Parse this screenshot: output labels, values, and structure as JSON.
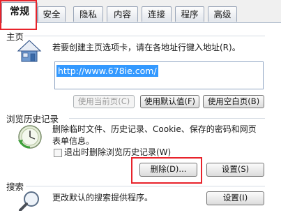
{
  "tabs": [
    "常规",
    "安全",
    "隐私",
    "内容",
    "连接",
    "程序",
    "高级"
  ],
  "homepage": {
    "title": "主页",
    "description": "若要创建主页选项卡，请在各地址行键入地址(R)。",
    "url": "http://www.678ie.com/",
    "buttons": {
      "use_current": "使用当前页(C)",
      "use_default": "使用默认值(F)",
      "use_blank": "使用空白页(B)"
    }
  },
  "history": {
    "title": "浏览历史记录",
    "description_line1": "删除临时文件、历史记录、Cookie、保存的密码和网页",
    "description_line2": "表单信息。",
    "checkbox_label": "退出时删除浏览历史记录(W)",
    "buttons": {
      "delete": "删除(D)...",
      "settings": "设置(S)"
    }
  },
  "search": {
    "title": "搜索",
    "description": "更改默认的搜索提供程序。",
    "buttons": {
      "settings": "设置(I)"
    }
  },
  "highlight_color": "#e8232b"
}
